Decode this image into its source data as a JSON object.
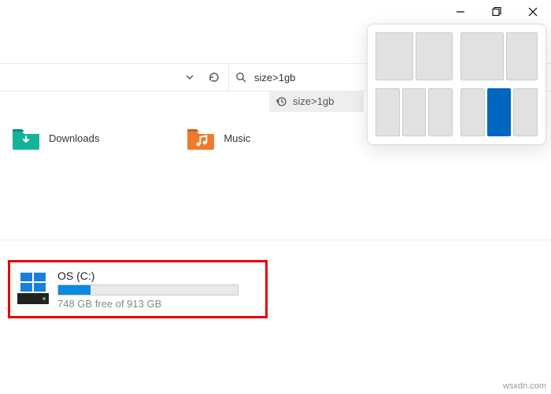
{
  "search": {
    "query": "size>1gb",
    "history_entry": "size>1gb"
  },
  "folders": [
    {
      "label": "Downloads"
    },
    {
      "label": "Music"
    }
  ],
  "drive": {
    "name": "OS (C:)",
    "free_text": "748 GB free of 913 GB",
    "used_percent": 18
  },
  "snap_layouts": {
    "active_layout_index": 3,
    "active_cell_index": 1
  },
  "watermark": "wsxdn.com"
}
